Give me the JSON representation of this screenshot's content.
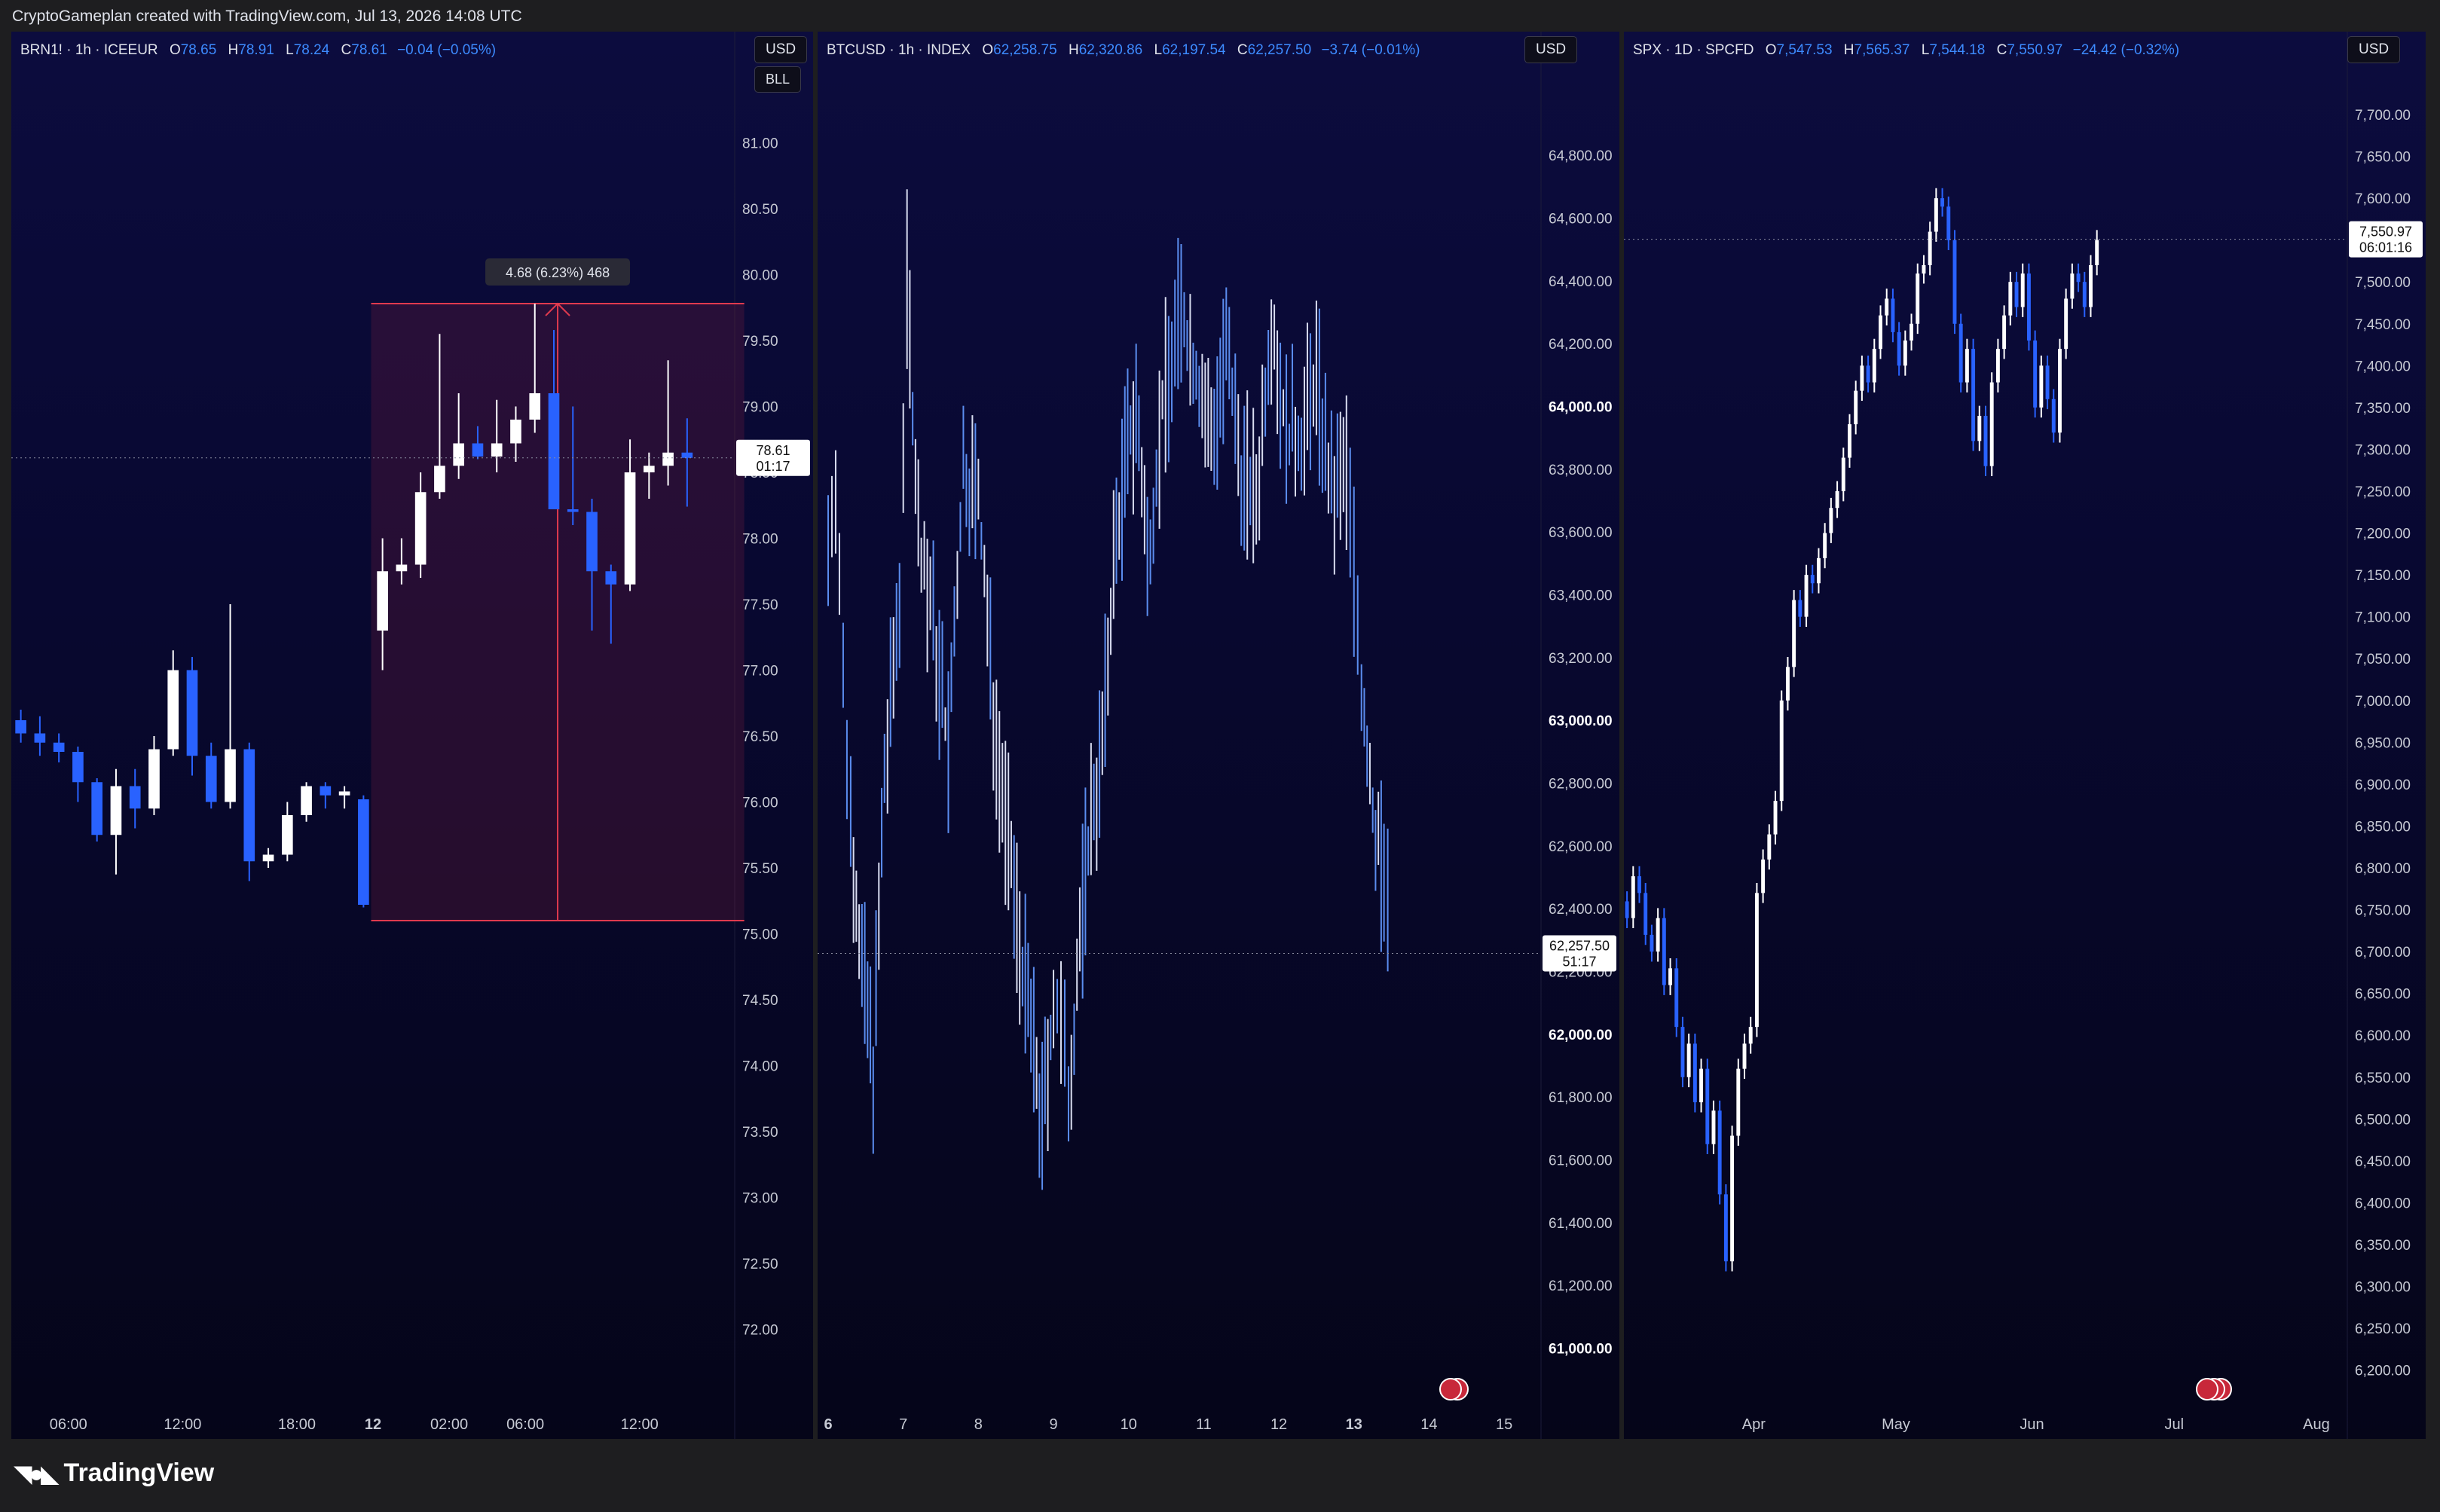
{
  "header": {
    "credit": "CryptoGameplan created with TradingView.com, Jul 13, 2026 14:08 UTC"
  },
  "footer": {
    "brand": "TradingView"
  },
  "colors": {
    "up": "#ffffff",
    "down": "#2962ff",
    "btc_line": "#5b8def",
    "range_box": "#e03a4e",
    "background": "#080830"
  },
  "panels": {
    "brn": {
      "symbol": "BRN1! · 1h · ICEEUR",
      "o_label": "O",
      "o": "78.65",
      "h_label": "H",
      "h": "78.91",
      "l_label": "L",
      "l": "78.24",
      "c_label": "C",
      "c": "78.61",
      "change": "−0.04 (−0.05%)",
      "currency": "USD",
      "unit_button": "BLL",
      "last_price": "78.61",
      "countdown": "01:17",
      "measure_label": "4.68 (6.23%) 468"
    },
    "btc": {
      "symbol": "BTCUSD · 1h · INDEX",
      "o_label": "O",
      "o": "62,258.75",
      "h_label": "H",
      "h": "62,320.86",
      "l_label": "L",
      "l": "62,197.54",
      "c_label": "C",
      "c": "62,257.50",
      "change": "−3.74 (−0.01%)",
      "currency": "USD",
      "last_price": "62,257.50",
      "countdown": "51:17"
    },
    "spx": {
      "symbol": "SPX · 1D · SPCFD",
      "o_label": "O",
      "o": "7,547.53",
      "h_label": "H",
      "h": "7,565.37",
      "l_label": "L",
      "l": "7,544.18",
      "c_label": "C",
      "c": "7,550.97",
      "change": "−24.42 (−0.32%)",
      "currency": "USD",
      "last_price": "7,550.97",
      "countdown": "06:01:16"
    }
  },
  "chart_data": [
    {
      "id": "brn",
      "type": "candlestick",
      "title": "BRN1! · 1h · ICEEUR",
      "ylim": [
        71.5,
        81.5
      ],
      "y_ticks": [
        "72.00",
        "72.50",
        "73.00",
        "73.50",
        "74.00",
        "74.50",
        "75.00",
        "75.50",
        "76.00",
        "76.50",
        "77.00",
        "77.50",
        "78.00",
        "78.50",
        "79.00",
        "79.50",
        "80.00",
        "80.50",
        "81.00"
      ],
      "x_ticks": [
        {
          "label": "06:00",
          "i": 2.5,
          "bold": false
        },
        {
          "label": "12:00",
          "i": 8.5,
          "bold": false
        },
        {
          "label": "18:00",
          "i": 14.5,
          "bold": false
        },
        {
          "label": "12",
          "i": 18.5,
          "bold": true
        },
        {
          "label": "02:00",
          "i": 22.5,
          "bold": false
        },
        {
          "label": "06:00",
          "i": 26.5,
          "bold": false
        },
        {
          "label": "12:00",
          "i": 32.5,
          "bold": false
        }
      ],
      "n_slots": 38,
      "measure": {
        "from_i": 18.4,
        "to_i": 38,
        "low": 75.1,
        "high": 79.78
      },
      "candles": [
        [
          76.62,
          76.7,
          76.45,
          76.52
        ],
        [
          76.52,
          76.65,
          76.35,
          76.45
        ],
        [
          76.45,
          76.52,
          76.3,
          76.38
        ],
        [
          76.38,
          76.42,
          76.0,
          76.15
        ],
        [
          76.15,
          76.18,
          75.7,
          75.75
        ],
        [
          75.75,
          76.25,
          75.45,
          76.12
        ],
        [
          76.12,
          76.25,
          75.8,
          75.95
        ],
        [
          75.95,
          76.5,
          75.9,
          76.4
        ],
        [
          76.4,
          77.15,
          76.35,
          77.0
        ],
        [
          77.0,
          77.1,
          76.2,
          76.35
        ],
        [
          76.35,
          76.45,
          75.95,
          76.0
        ],
        [
          76.0,
          77.5,
          75.95,
          76.4
        ],
        [
          76.4,
          76.45,
          75.4,
          75.55
        ],
        [
          75.55,
          75.65,
          75.5,
          75.6
        ],
        [
          75.6,
          76.0,
          75.55,
          75.9
        ],
        [
          75.9,
          76.15,
          75.85,
          76.12
        ],
        [
          76.12,
          76.15,
          75.95,
          76.05
        ],
        [
          76.05,
          76.12,
          75.95,
          76.08
        ],
        [
          76.02,
          76.05,
          75.2,
          75.22
        ],
        [
          77.3,
          78.0,
          77.0,
          77.75
        ],
        [
          77.75,
          78.0,
          77.65,
          77.8
        ],
        [
          77.8,
          78.5,
          77.7,
          78.35
        ],
        [
          78.35,
          79.55,
          78.3,
          78.55
        ],
        [
          78.55,
          79.1,
          78.45,
          78.72
        ],
        [
          78.72,
          78.85,
          78.6,
          78.62
        ],
        [
          78.62,
          79.05,
          78.5,
          78.72
        ],
        [
          78.72,
          79.0,
          78.58,
          78.9
        ],
        [
          78.9,
          79.78,
          78.8,
          79.1
        ],
        [
          79.1,
          79.58,
          78.3,
          78.22
        ],
        [
          78.22,
          79.0,
          78.1,
          78.2
        ],
        [
          78.2,
          78.3,
          77.3,
          77.75
        ],
        [
          77.75,
          77.8,
          77.2,
          77.65
        ],
        [
          77.65,
          78.75,
          77.6,
          78.5
        ],
        [
          78.5,
          78.65,
          78.3,
          78.55
        ],
        [
          78.55,
          79.35,
          78.4,
          78.65
        ],
        [
          78.65,
          78.91,
          78.24,
          78.61
        ]
      ]
    },
    {
      "id": "btc",
      "type": "candlestick",
      "title": "BTCUSD · 1h · INDEX",
      "ylim": [
        60850,
        65050
      ],
      "y_ticks": [
        "61,000.00",
        "61,200.00",
        "61,400.00",
        "61,600.00",
        "61,800.00",
        "62,000.00",
        "62,200.00",
        "62,400.00",
        "62,600.00",
        "62,800.00",
        "63,000.00",
        "63,200.00",
        "63,400.00",
        "63,600.00",
        "63,800.00",
        "64,000.00",
        "64,200.00",
        "64,400.00",
        "64,600.00",
        "64,800.00"
      ],
      "x_ticks": [
        {
          "label": "6",
          "day": 0,
          "bold": true
        },
        {
          "label": "7",
          "day": 1,
          "bold": false
        },
        {
          "label": "8",
          "day": 2,
          "bold": false
        },
        {
          "label": "9",
          "day": 3,
          "bold": false
        },
        {
          "label": "10",
          "day": 4,
          "bold": false
        },
        {
          "label": "11",
          "day": 5,
          "bold": false
        },
        {
          "label": "12",
          "day": 6,
          "bold": false
        },
        {
          "label": "13",
          "day": 7,
          "bold": true
        },
        {
          "label": "14",
          "day": 8,
          "bold": false
        },
        {
          "label": "15",
          "day": 9,
          "bold": false
        }
      ],
      "days_span": [
        0,
        9.35
      ],
      "path_days": [
        0,
        0.1,
        0.2,
        0.3,
        0.45,
        0.6,
        0.75,
        0.95,
        1.05,
        1.2,
        1.4,
        1.6,
        1.8,
        2.0,
        2.2,
        2.4,
        2.55,
        2.7,
        2.85,
        3.0,
        3.1,
        3.2,
        3.35,
        3.5,
        3.65,
        3.8,
        3.95,
        4.1,
        4.25,
        4.45,
        4.7,
        4.9,
        5.1,
        5.3,
        5.5,
        5.7,
        5.9,
        6.1,
        6.3,
        6.5,
        6.7,
        6.9,
        7.0,
        7.1,
        7.25,
        7.4,
        7.5
      ],
      "path_prices": [
        63550,
        63800,
        63100,
        62700,
        62200,
        61900,
        62800,
        63400,
        64400,
        63600,
        63300,
        62900,
        63800,
        63700,
        63050,
        62600,
        62300,
        62000,
        61700,
        62100,
        62000,
        61800,
        62300,
        62700,
        62900,
        63500,
        63800,
        64000,
        63500,
        64000,
        64300,
        64100,
        63900,
        64150,
        63800,
        63700,
        64300,
        63900,
        63900,
        64100,
        63700,
        63800,
        63500,
        63100,
        62700,
        62500,
        62257
      ]
    },
    {
      "id": "spx",
      "type": "candlestick",
      "title": "SPX · 1D · SPCFD",
      "ylim": [
        6170,
        7745
      ],
      "y_ticks": [
        "6,200.00",
        "6,250.00",
        "6,300.00",
        "6,350.00",
        "6,400.00",
        "6,450.00",
        "6,500.00",
        "6,550.00",
        "6,600.00",
        "6,650.00",
        "6,700.00",
        "6,750.00",
        "6,800.00",
        "6,850.00",
        "6,900.00",
        "6,950.00",
        "7,000.00",
        "7,050.00",
        "7,100.00",
        "7,150.00",
        "7,200.00",
        "7,250.00",
        "7,300.00",
        "7,350.00",
        "7,400.00",
        "7,450.00",
        "7,500.00",
        "7,550.00",
        "7,600.00",
        "7,650.00",
        "7,700.00"
      ],
      "x_ticks": [
        {
          "label": "Apr",
          "i": 20.5,
          "bold": false
        },
        {
          "label": "May",
          "i": 43.5,
          "bold": false
        },
        {
          "label": "Jun",
          "i": 65.5,
          "bold": false
        },
        {
          "label": "Jul",
          "i": 88.5,
          "bold": false
        },
        {
          "label": "Aug",
          "i": 111.5,
          "bold": false
        }
      ],
      "n_slots": 117,
      "closes": [
        6740,
        6790,
        6770,
        6720,
        6700,
        6740,
        6660,
        6680,
        6610,
        6550,
        6590,
        6520,
        6560,
        6470,
        6510,
        6410,
        6330,
        6480,
        6560,
        6590,
        6610,
        6770,
        6810,
        6840,
        6880,
        7000,
        7040,
        7120,
        7100,
        7150,
        7140,
        7170,
        7200,
        7230,
        7250,
        7290,
        7330,
        7370,
        7400,
        7380,
        7420,
        7460,
        7480,
        7440,
        7400,
        7430,
        7450,
        7510,
        7520,
        7560,
        7600,
        7590,
        7550,
        7450,
        7380,
        7420,
        7310,
        7340,
        7280,
        7380,
        7420,
        7460,
        7500,
        7470,
        7510,
        7430,
        7350,
        7400,
        7360,
        7320,
        7420,
        7480,
        7510,
        7500,
        7470,
        7520,
        7550
      ]
    }
  ]
}
